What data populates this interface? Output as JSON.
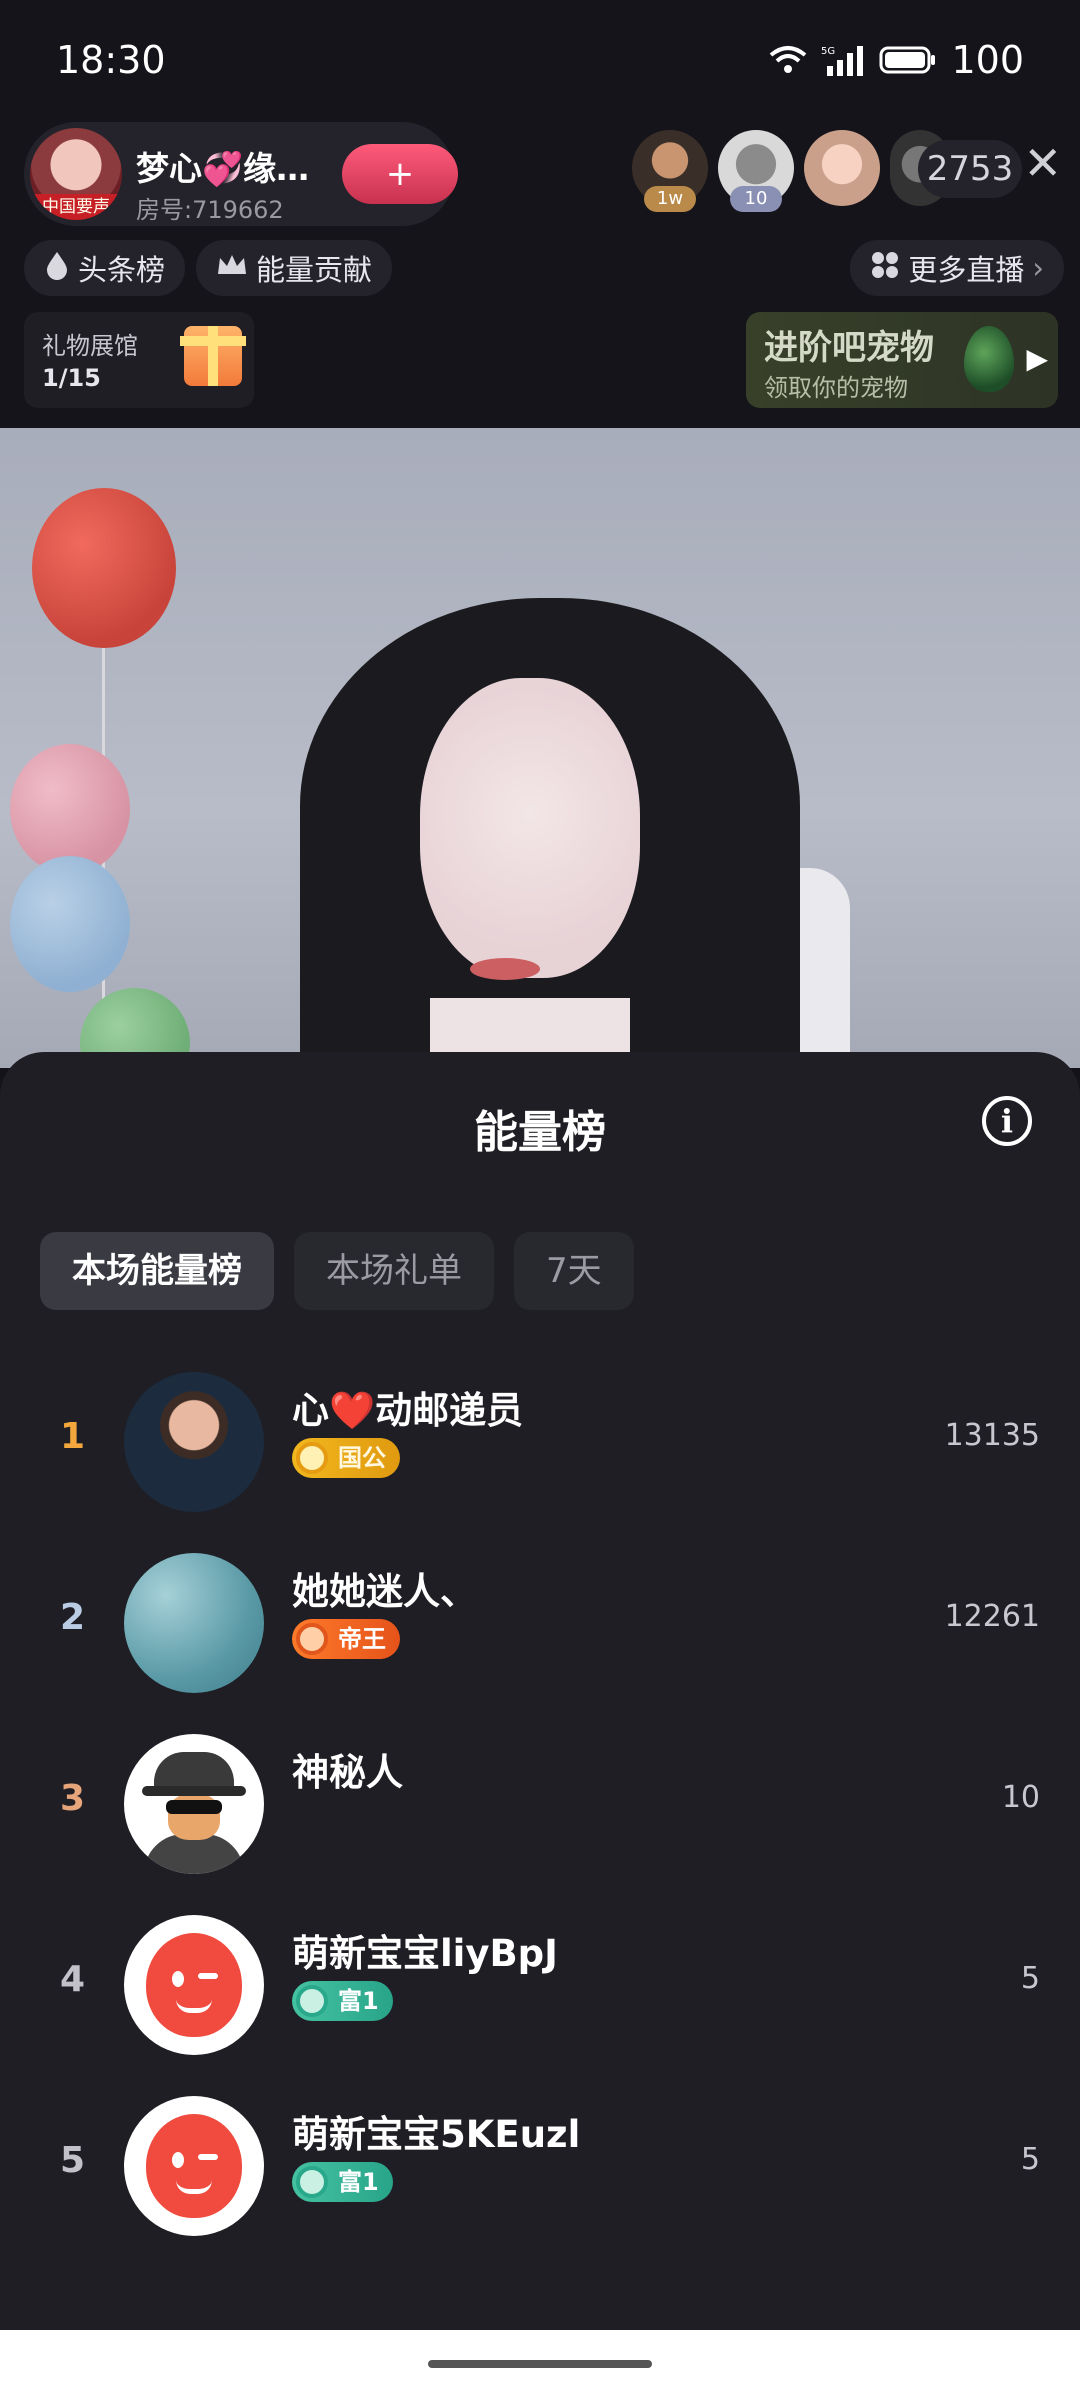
{
  "status_bar": {
    "time": "18:30",
    "network": "5G",
    "battery": "100"
  },
  "host": {
    "name": "梦心💞缘…",
    "room_no": "房号:719662",
    "avatar_tag": "中国要声",
    "follow_label": "+"
  },
  "viewers": [
    {
      "badge": "1w"
    },
    {
      "badge": "10"
    },
    {
      "badge": ""
    },
    {
      "badge": ""
    }
  ],
  "viewer_count": "2753",
  "chips": {
    "headline": "头条榜",
    "energy": "能量贡献",
    "more_live": "更多直播"
  },
  "gift_hall": {
    "title": "礼物展馆",
    "progress": "1/15"
  },
  "pet_banner": {
    "title": "进阶吧宠物",
    "subtitle": "领取你的宠物"
  },
  "sheet": {
    "title": "能量榜",
    "tabs": [
      {
        "label": "本场能量榜",
        "active": true
      },
      {
        "label": "本场礼单",
        "active": false
      },
      {
        "label": "7天",
        "active": false
      }
    ],
    "rows": [
      {
        "rank": "1",
        "name_a": "心",
        "name_heart": "❤️",
        "name_b": "动邮递员",
        "badge": "国公",
        "score": "13135"
      },
      {
        "rank": "2",
        "name": "她她迷人、",
        "badge": "帝王",
        "score": "12261"
      },
      {
        "rank": "3",
        "name": "神秘人",
        "badge": "",
        "score": "10"
      },
      {
        "rank": "4",
        "name": "萌新宝宝liyBpJ",
        "badge": "富1",
        "score": "5"
      },
      {
        "rank": "5",
        "name": "萌新宝宝5KEuzl",
        "badge": "富1",
        "score": "5"
      }
    ]
  }
}
